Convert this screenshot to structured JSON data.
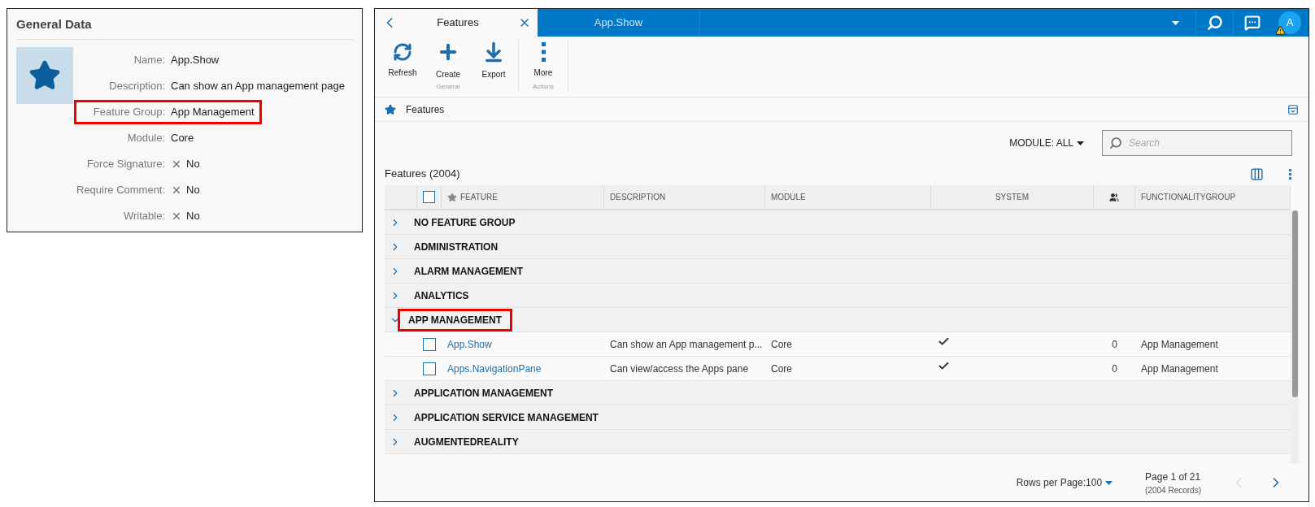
{
  "general_data": {
    "title": "General Data",
    "fields": [
      {
        "label": "Name:",
        "value": "App.Show",
        "kind": "text",
        "highlighted": false
      },
      {
        "label": "Description:",
        "value": "Can show an App management page",
        "kind": "text",
        "highlighted": false
      },
      {
        "label": "Feature Group:",
        "value": "App Management",
        "kind": "text",
        "highlighted": true
      },
      {
        "label": "Module:",
        "value": "Core",
        "kind": "text",
        "highlighted": false
      },
      {
        "label": "Force Signature:",
        "value": "No",
        "kind": "flag",
        "highlighted": false
      },
      {
        "label": "Require Comment:",
        "value": "No",
        "kind": "flag",
        "highlighted": false
      },
      {
        "label": "Writable:",
        "value": "No",
        "kind": "flag",
        "highlighted": false
      }
    ]
  },
  "app": {
    "tabs": [
      {
        "label": "Features",
        "selected": true
      },
      {
        "label": "App.Show",
        "selected": false
      }
    ],
    "avatar": "A",
    "toolbar": [
      {
        "label": "General",
        "buttons": [
          {
            "label": "Refresh",
            "kind": "refresh"
          },
          {
            "label": "Create",
            "kind": "create"
          },
          {
            "label": "Export",
            "kind": "export"
          }
        ]
      },
      {
        "label": "Actions",
        "buttons": [
          {
            "label": "More",
            "kind": "more"
          }
        ]
      }
    ],
    "breadcrumb": "Features",
    "module_filter": "MODULE: ALL",
    "search": {
      "placeholder": "Search"
    },
    "table_title": "Features (2004)",
    "select_all": {
      "checked": false
    },
    "columns": [
      {
        "kind": "check"
      },
      {
        "kind": "text",
        "label": "FEATURE"
      },
      {
        "kind": "text",
        "label": "DESCRIPTION"
      },
      {
        "kind": "text",
        "label": "MODULE"
      },
      {
        "kind": "center",
        "label": "SYSTEM"
      },
      {
        "kind": "icon"
      },
      {
        "kind": "text",
        "label": "FUNCTIONALITYGROUP"
      }
    ],
    "groups": [
      {
        "name": "NO FEATURE GROUP",
        "expanded": false,
        "highlighted": false
      },
      {
        "name": "ADMINISTRATION",
        "expanded": false,
        "highlighted": false
      },
      {
        "name": "ALARM MANAGEMENT",
        "expanded": false,
        "highlighted": false
      },
      {
        "name": "ANALYTICS",
        "expanded": false,
        "highlighted": false
      },
      {
        "name": "APP MANAGEMENT",
        "expanded": true,
        "highlighted": true,
        "rows": [
          {
            "feature": "App.Show",
            "description": "Can show an App management p...",
            "module": "Core",
            "system": true,
            "count": "0",
            "group": "App Management",
            "checked": false
          },
          {
            "feature": "Apps.NavigationPane",
            "description": "Can view/access the Apps pane",
            "module": "Core",
            "system": true,
            "count": "0",
            "group": "App Management",
            "checked": false
          }
        ]
      },
      {
        "name": "APPLICATION MANAGEMENT",
        "expanded": false,
        "highlighted": false
      },
      {
        "name": "APPLICATION SERVICE MANAGEMENT",
        "expanded": false,
        "highlighted": false
      },
      {
        "name": "AUGMENTEDREALITY",
        "expanded": false,
        "highlighted": false
      }
    ],
    "footer": {
      "rows_per_page": "Rows per Page:100",
      "page": "Page 1 of 21",
      "records": "(2004 Records)"
    }
  }
}
